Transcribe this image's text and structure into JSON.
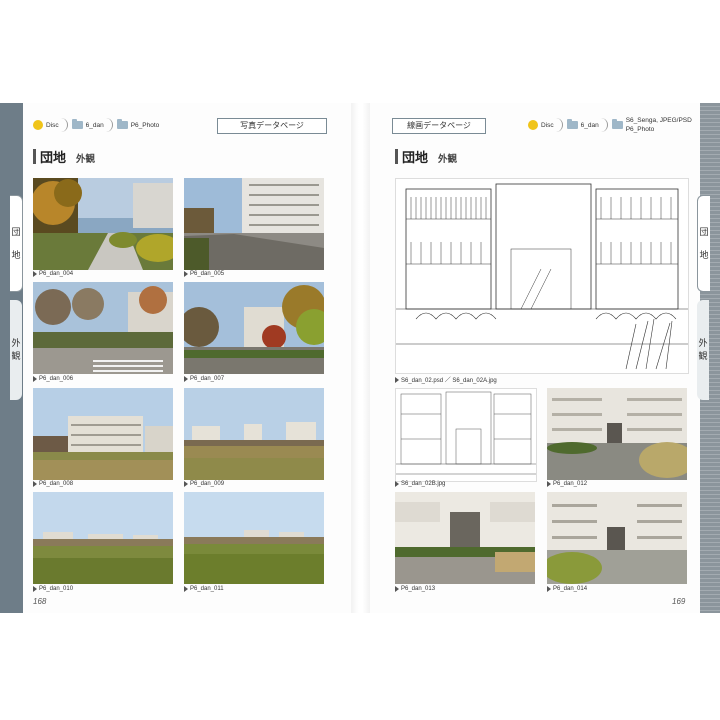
{
  "left": {
    "breadcrumb": [
      "Disc",
      "6_dan",
      "P6_Photo"
    ],
    "page_label": "写真データページ",
    "section_title": "団地",
    "section_sub": "外観",
    "side_tab_1": [
      "団",
      "地"
    ],
    "side_tab_2": [
      "外",
      "観"
    ],
    "page_number": "168",
    "captions": [
      "P6_dan_004",
      "P6_dan_005",
      "P6_dan_006",
      "P6_dan_007",
      "P6_dan_008",
      "P6_dan_009",
      "P6_dan_010",
      "P6_dan_011"
    ]
  },
  "right": {
    "breadcrumb": [
      "Disc",
      "6_dan"
    ],
    "breadcrumb_last_1": "S6_Senga, JPEG/PSD",
    "breadcrumb_last_2": "P6_Photo",
    "page_label": "線画データページ",
    "section_title": "団地",
    "section_sub": "外観",
    "side_tab_1": [
      "団",
      "地"
    ],
    "side_tab_2": [
      "外",
      "観"
    ],
    "page_number": "169",
    "captions": [
      "S6_dan_02.psd ／ S6_dan_02A.jpg",
      "S6_dan_02B.jpg",
      "P6_dan_012",
      "P6_dan_013",
      "P6_dan_014"
    ]
  }
}
